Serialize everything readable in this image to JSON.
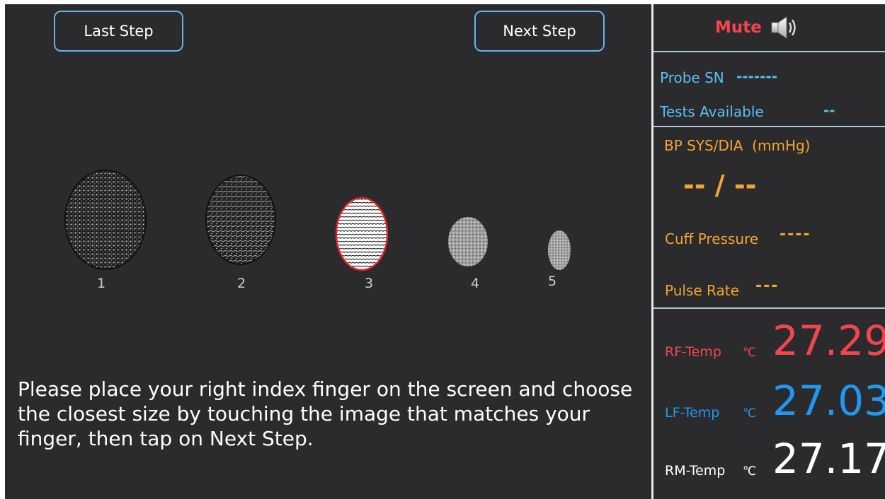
{
  "nav": {
    "last_step_label": "Last Step",
    "next_step_label": "Next Step"
  },
  "fingers": [
    {
      "label": "1",
      "selected": false
    },
    {
      "label": "2",
      "selected": false
    },
    {
      "label": "3",
      "selected": true
    },
    {
      "label": "4",
      "selected": false
    },
    {
      "label": "5",
      "selected": false
    }
  ],
  "instructions": "Please place your right index finger on the screen and choose the closest size by touching the image that matches your finger, then tap on Next Step.",
  "sidebar": {
    "mute_label": "Mute",
    "mute_icon": "speaker-icon",
    "probe_sn_label": "Probe SN",
    "probe_sn_value": "-------",
    "tests_available_label": "Tests Available",
    "tests_available_value": "--",
    "bp_label": "BP SYS/DIA  (mmHg)",
    "bp_value": "-- / --",
    "cuff_pressure_label": "Cuff Pressure",
    "cuff_pressure_value": "----",
    "pulse_rate_label": "Pulse Rate",
    "pulse_rate_value": "---",
    "temps": [
      {
        "label": "RF-Temp",
        "unit": "℃",
        "value": "27.29",
        "color": "#f2454e"
      },
      {
        "label": "LF-Temp",
        "unit": "℃",
        "value": "27.03",
        "color": "#1e98f0"
      },
      {
        "label": "RM-Temp",
        "unit": "℃",
        "value": "27.17",
        "color": "#ffffff"
      }
    ]
  },
  "colors": {
    "background": "#2b2a2d",
    "button_border": "#63b6e6",
    "mute": "#f2454e",
    "blue": "#57c1f0",
    "orange": "#f2a531",
    "selection_ring": "#e0262b"
  }
}
